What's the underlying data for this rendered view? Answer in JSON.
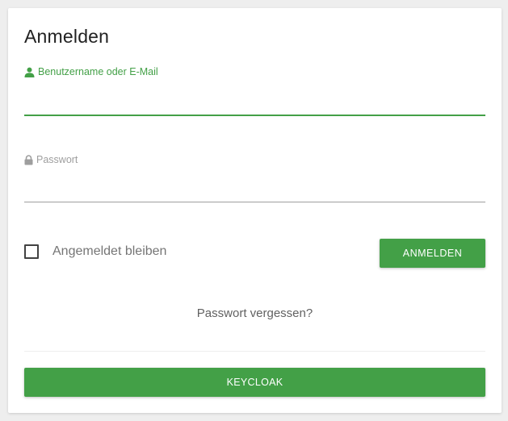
{
  "login": {
    "title": "Anmelden",
    "username": {
      "label": "Benutzername oder E-Mail",
      "value": "",
      "icon": "user-icon"
    },
    "password": {
      "label": "Passwort",
      "value": "",
      "icon": "lock-icon"
    },
    "remember_me": {
      "label": "Angemeldet bleiben",
      "checked": false
    },
    "submit_label": "ANMELDEN",
    "forgot_password": "Passwort vergessen?",
    "providers": [
      {
        "label": "KEYCLOAK"
      }
    ]
  },
  "colors": {
    "accent": "#43a047",
    "muted": "#9e9e9e",
    "text": "#212121"
  }
}
